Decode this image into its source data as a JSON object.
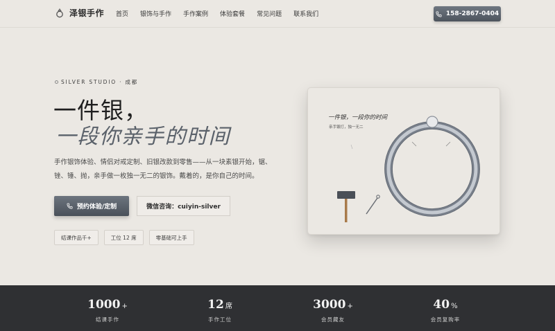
{
  "header": {
    "brand": "泽银手作",
    "nav": [
      "首页",
      "银饰与手作",
      "手作案例",
      "体验套餐",
      "常见问题",
      "联系我们"
    ],
    "phone": "158-2867-0404"
  },
  "hero": {
    "eyebrow": "SILVER STUDIO · 成都",
    "title_line1": "一件银，",
    "title_line2": "一段你亲手的时间",
    "description": "手作银饰体验、情侣对戒定制、旧银改款到零售——从一块素银开始，锯、锉、锤、抛，亲手做一枚独一无二的银饰。戴着的，是你自己的时间。",
    "cta_primary": "预约体验/定制",
    "cta_secondary": "微信咨询：cuiyin-silver",
    "tags": [
      "结课作品千+",
      "工位 12 席",
      "零基础可上手"
    ]
  },
  "card": {
    "title": "一件银，一段你的时间",
    "subtitle": "亲手锻打，独一无二"
  },
  "stats": [
    {
      "value": "1000",
      "suffix": "+",
      "label": "结课手作"
    },
    {
      "value": "12",
      "suffix": "席",
      "label": "手作工位"
    },
    {
      "value": "3000",
      "suffix": "+",
      "label": "会员藏友"
    },
    {
      "value": "40",
      "suffix": "%",
      "label": "会员复购率"
    }
  ],
  "icons": {
    "brand": "ring-icon",
    "phone": "phone-icon",
    "eyebrow": "circle-dot-icon",
    "illustration": [
      "silver-ring-icon",
      "hammer-icon",
      "awl-icon"
    ]
  },
  "colors": {
    "background": "#ebe8e3",
    "accent": "#565d66",
    "stats_band": "#2f3033"
  }
}
